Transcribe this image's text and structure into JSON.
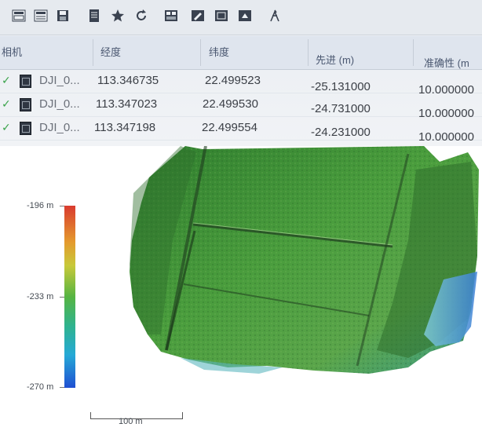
{
  "grid": {
    "columns": [
      "相机",
      "经度",
      "纬度",
      "先进 (m)",
      "准确性 (m"
    ],
    "rows": [
      {
        "name": "DJI_0...",
        "longitude": "113.346735",
        "latitude": "22.499523",
        "altitude": "-25.131000",
        "accuracy": "10.000000"
      },
      {
        "name": "DJI_0...",
        "longitude": "113.347023",
        "latitude": "22.499530",
        "altitude": "-24.731000",
        "accuracy": "10.000000"
      },
      {
        "name": "DJI_0...",
        "longitude": "113.347198",
        "latitude": "22.499554",
        "altitude": "-24.231000",
        "accuracy": "10.000000"
      }
    ]
  },
  "legend": {
    "max": "-196 m",
    "mid": "-233 m",
    "min": "-270 m"
  },
  "scale": {
    "label": "100 m"
  },
  "colors": {
    "legend_top": "#d93b2f",
    "legend_mid": "#56b442",
    "legend_bottom": "#1f4fd2",
    "terrain_green": "#3f8f3a"
  }
}
